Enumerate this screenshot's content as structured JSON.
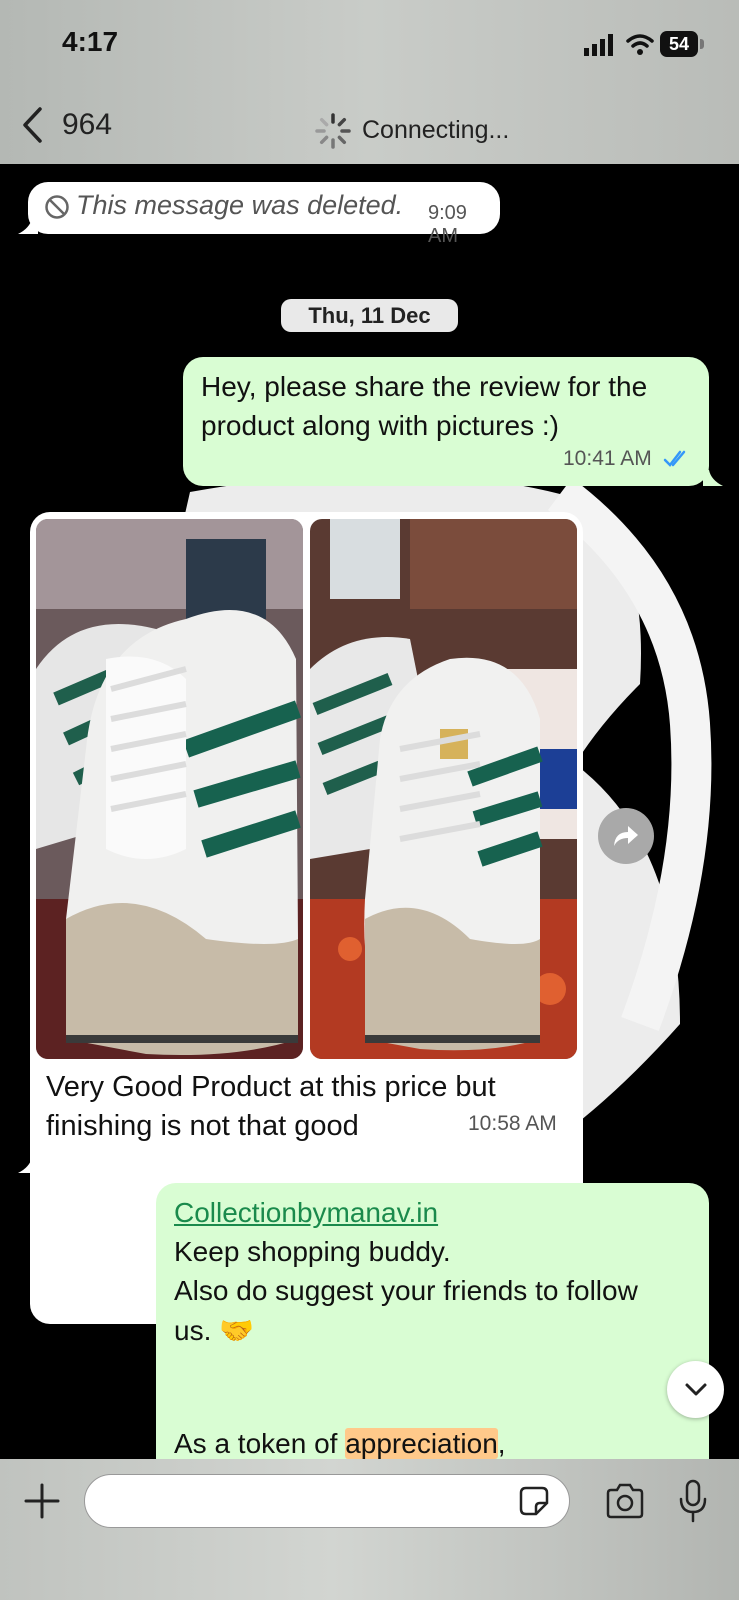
{
  "status_bar": {
    "time": "4:17",
    "battery": "54"
  },
  "header": {
    "contact_name": "964",
    "connection_status": "Connecting..."
  },
  "messages": {
    "deleted": {
      "text": "This message was deleted.",
      "time": "9:09 AM"
    },
    "date_separator": "Thu, 11 Dec",
    "request": {
      "text": "Hey, please share the review for the product along with pictures :)",
      "time": "10:41 AM",
      "status": "read"
    },
    "review": {
      "caption": "Very Good Product at this price but finishing is not that good",
      "time": "10:58 AM",
      "image_count": 2
    },
    "reply": {
      "link": "Collectionbymanav.in",
      "line1": "Keep shopping buddy.",
      "line2": "Also do suggest your friends to follow",
      "line3": "us. 🤝",
      "line4_prefix": "As a token of ",
      "line4_highlight": "appreciation",
      "line4_suffix": ","
    }
  },
  "input": {
    "value": ""
  },
  "colors": {
    "outgoing_bubble": "#d9fdd3",
    "incoming_bubble": "#ffffff",
    "link": "#1a8a4c",
    "read_ticks": "#3497f9",
    "highlight": "#ffc98a"
  }
}
